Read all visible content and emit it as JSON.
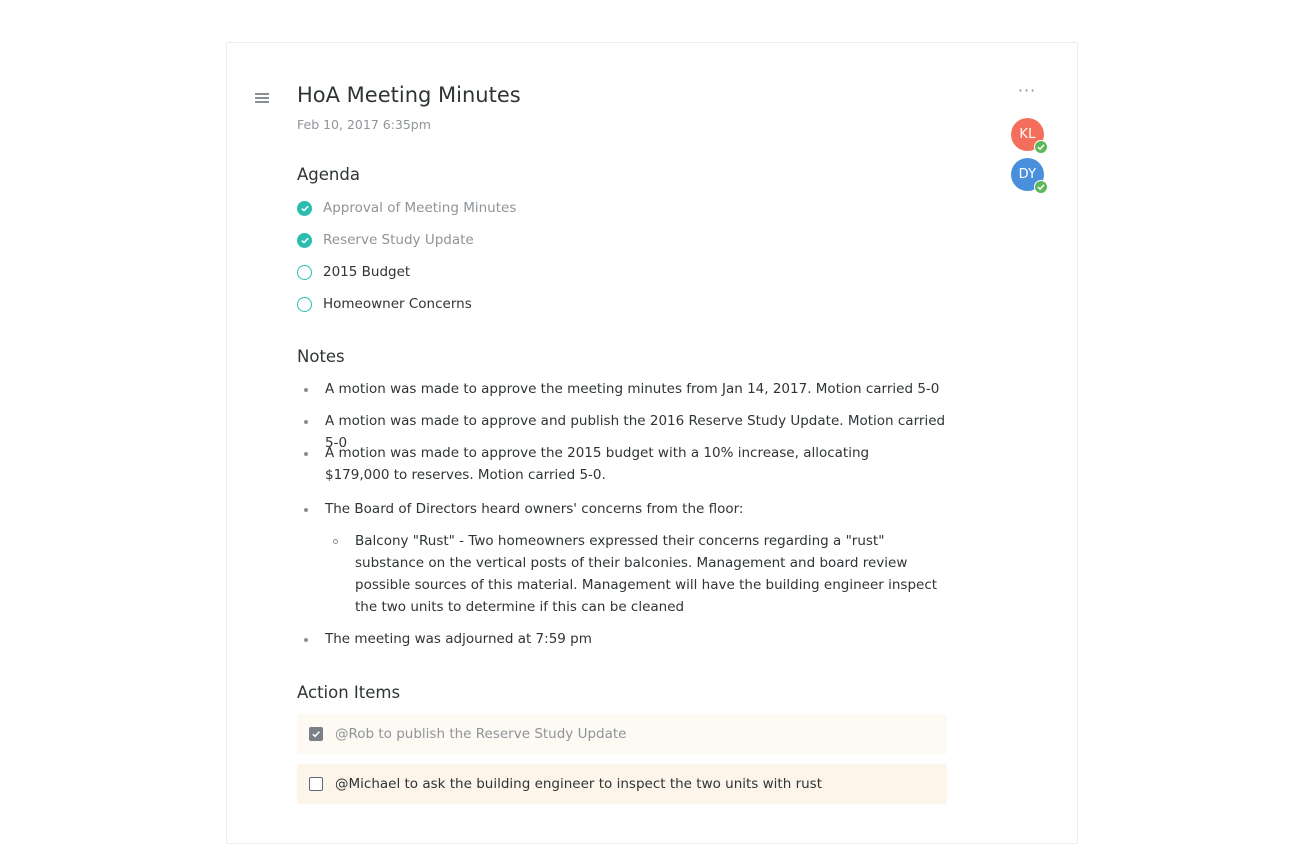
{
  "doc": {
    "title": "HoA Meeting Minutes",
    "date": "Feb 10, 2017 6:35pm",
    "more_label": "···"
  },
  "collaborators": [
    {
      "initials": "KL",
      "color": "#f36f5b",
      "status": "online"
    },
    {
      "initials": "DY",
      "color": "#4a8fdc",
      "status": "online"
    }
  ],
  "agenda": {
    "heading": "Agenda",
    "items": [
      {
        "label": "Approval of Meeting Minutes",
        "done": true
      },
      {
        "label": "Reserve Study Update",
        "done": true
      },
      {
        "label": "2015 Budget",
        "done": false
      },
      {
        "label": "Homeowner Concerns",
        "done": false
      }
    ]
  },
  "notes": {
    "heading": "Notes",
    "items": [
      {
        "text": "A motion was made to approve the meeting minutes from Jan 14, 2017. Motion carried 5-0"
      },
      {
        "text": "A motion was made to approve and publish the 2016 Reserve Study Update. Motion carried 5-0"
      },
      {
        "text": "A motion was made to approve the 2015 budget with a 10% increase, allocating $179,000 to reserves. Motion carried 5-0."
      },
      {
        "text": "The Board of Directors heard owners' concerns from the floor:",
        "subitems": [
          {
            "text": "Balcony \"Rust\" - Two homeowners expressed their concerns regarding a \"rust\" substance on the vertical posts of their balconies. Management and board review possible sources of this material. Management will have the building engineer inspect the two units to determine if this can be cleaned"
          }
        ]
      },
      {
        "text": "The meeting was adjourned at 7:59 pm"
      }
    ]
  },
  "action_items": {
    "heading": "Action Items",
    "items": [
      {
        "label": "@Rob to publish the Reserve Study Update",
        "checked": true
      },
      {
        "label": "@Michael to ask the building engineer to inspect the two units with rust",
        "checked": false
      }
    ]
  },
  "colors": {
    "accent_teal": "#2bbcb0",
    "online_green": "#5cb85c",
    "action_bg": "#fdf5ea"
  }
}
